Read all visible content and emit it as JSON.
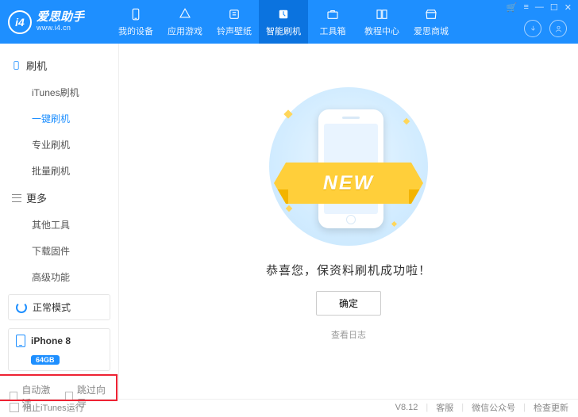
{
  "app": {
    "name": "爱思助手",
    "url": "www.i4.cn"
  },
  "topnav": [
    {
      "label": "我的设备"
    },
    {
      "label": "应用游戏"
    },
    {
      "label": "铃声壁纸"
    },
    {
      "label": "智能刷机"
    },
    {
      "label": "工具箱"
    },
    {
      "label": "教程中心"
    },
    {
      "label": "爱思商城"
    }
  ],
  "sidebar": {
    "group1": {
      "title": "刷机",
      "items": [
        "iTunes刷机",
        "一键刷机",
        "专业刷机",
        "批量刷机"
      ],
      "activeIndex": 1
    },
    "group2": {
      "title": "更多",
      "items": [
        "其他工具",
        "下载固件",
        "高级功能"
      ]
    }
  },
  "status": {
    "mode": "正常模式"
  },
  "device": {
    "name": "iPhone 8",
    "storage": "64GB"
  },
  "checks": {
    "autoActivate": "自动激活",
    "skipGuide": "跳过向导"
  },
  "content": {
    "ribbon": "NEW",
    "successMsg": "恭喜您，保资料刷机成功啦！",
    "okBtn": "确定",
    "viewLog": "查看日志"
  },
  "footer": {
    "blockItunes": "阻止iTunes运行",
    "version": "V8.12",
    "support": "客服",
    "wechat": "微信公众号",
    "update": "检查更新"
  }
}
